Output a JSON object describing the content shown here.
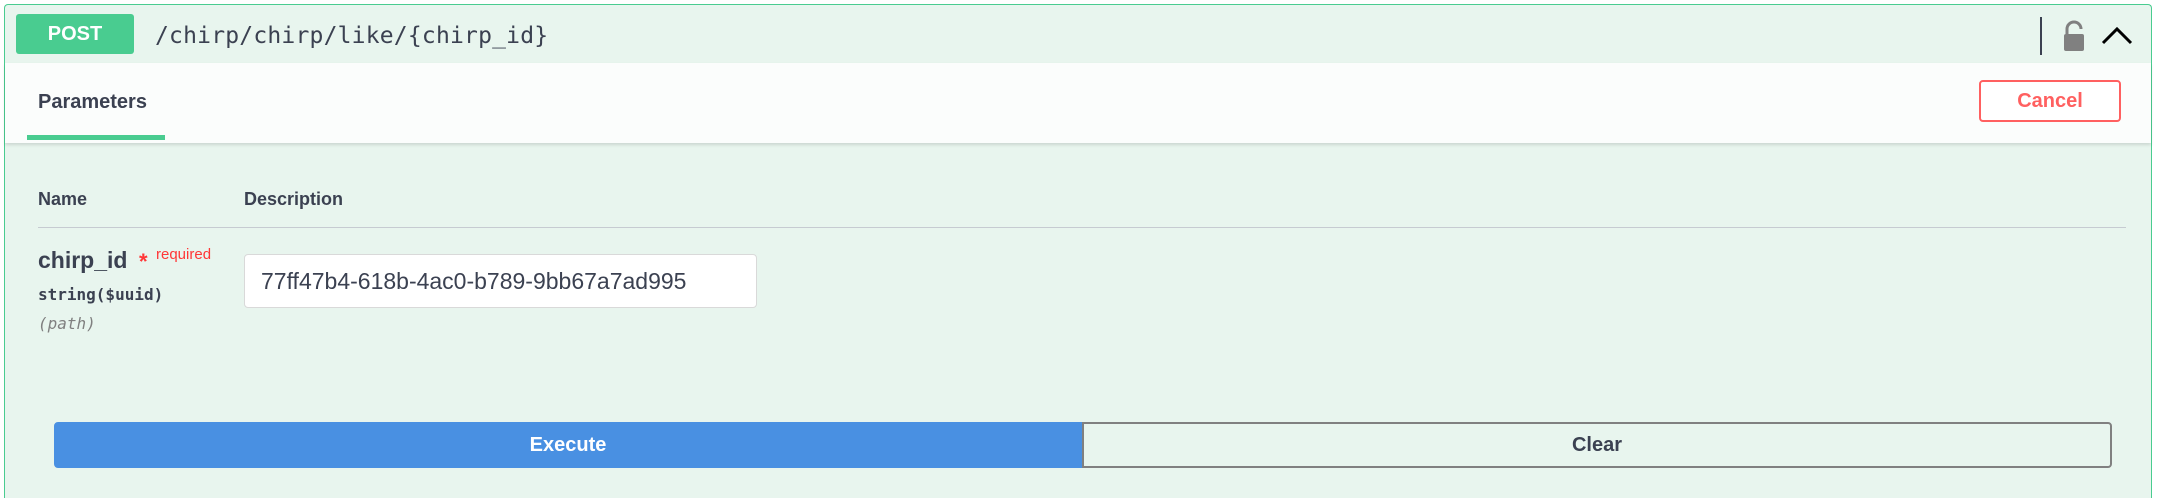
{
  "operation": {
    "method": "POST",
    "path": "/chirp/chirp/like/{chirp_id}"
  },
  "tabs": {
    "active": "Parameters",
    "cancel_label": "Cancel"
  },
  "table": {
    "headers": {
      "name": "Name",
      "description": "Description"
    },
    "params": [
      {
        "name": "chirp_id",
        "required_star": "*",
        "required_label": "required",
        "type": "string($uuid)",
        "in": "(path)",
        "value": "77ff47b4-618b-4ac0-b789-9bb67a7ad995"
      }
    ]
  },
  "actions": {
    "execute_label": "Execute",
    "clear_label": "Clear"
  },
  "icons": {
    "lock": "lock-icon",
    "collapse": "chevron-up-icon"
  },
  "colors": {
    "post": "#49cc90",
    "execute": "#4990e2",
    "cancel": "#ff6060",
    "required": "#ff3737"
  }
}
